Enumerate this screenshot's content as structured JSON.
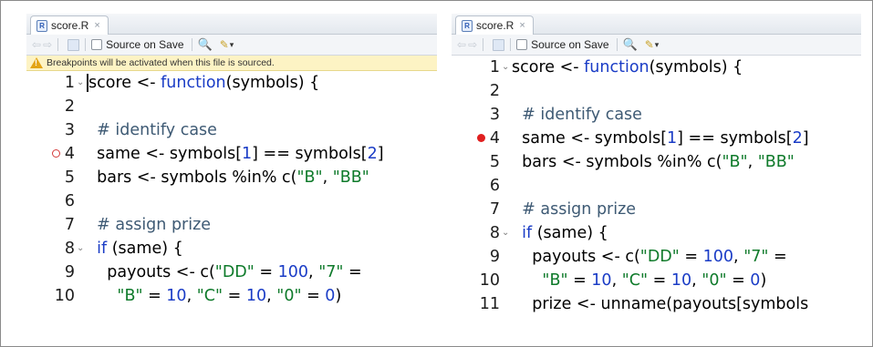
{
  "left_pane": {
    "tab": {
      "file_name": "score.R",
      "close": "×"
    },
    "toolbar": {
      "source_on_save": "Source on Save"
    },
    "notice": "Breakpoints will be activated when this file is sourced.",
    "breakpoint_line": 4,
    "lines": [
      {
        "n": "1",
        "fold": true,
        "html": "<span class=\"cursor\"></span>score &lt;- <span class=\"kw\">function</span>(symbols) {"
      },
      {
        "n": "2",
        "html": ""
      },
      {
        "n": "3",
        "html": "  <span class=\"cm\"># identify case</span>"
      },
      {
        "n": "4",
        "html": "  same &lt;- symbols[<span class=\"num\">1</span>] == symbols[<span class=\"num\">2</span>]"
      },
      {
        "n": "5",
        "html": "  bars &lt;- symbols %in% c(<span class=\"str\">\"B\"</span>, <span class=\"str\">\"BB\"</span>"
      },
      {
        "n": "6",
        "html": ""
      },
      {
        "n": "7",
        "html": "  <span class=\"cm\"># assign prize</span>"
      },
      {
        "n": "8",
        "fold": true,
        "html": "  <span class=\"kw\">if</span> (same) {"
      },
      {
        "n": "9",
        "html": "    payouts &lt;- c(<span class=\"str\">\"DD\"</span> = <span class=\"num\">100</span>, <span class=\"str\">\"7\"</span> ="
      },
      {
        "n": "10",
        "html": "      <span class=\"str\">\"B\"</span> = <span class=\"num\">10</span>, <span class=\"str\">\"C\"</span> = <span class=\"num\">10</span>, <span class=\"str\">\"0\"</span> = <span class=\"num\">0</span>)"
      }
    ]
  },
  "right_pane": {
    "tab": {
      "file_name": "score.R",
      "close": "×"
    },
    "toolbar": {
      "source_on_save": "Source on Save"
    },
    "breakpoint_line": 4,
    "lines": [
      {
        "n": "1",
        "fold": true,
        "html": "score &lt;- <span class=\"kw\">function</span>(symbols) {"
      },
      {
        "n": "2",
        "html": ""
      },
      {
        "n": "3",
        "html": "  <span class=\"cm\"># identify case</span>"
      },
      {
        "n": "4",
        "html": "  same &lt;- symbols[<span class=\"num\">1</span>] == symbols[<span class=\"num\">2</span>]"
      },
      {
        "n": "5",
        "html": "  bars &lt;- symbols %in% c(<span class=\"str\">\"B\"</span>, <span class=\"str\">\"BB\"</span>"
      },
      {
        "n": "6",
        "html": ""
      },
      {
        "n": "7",
        "html": "  <span class=\"cm\"># assign prize</span>"
      },
      {
        "n": "8",
        "fold": true,
        "html": "  <span class=\"kw\">if</span> (same) {"
      },
      {
        "n": "9",
        "html": "    payouts &lt;- c(<span class=\"str\">\"DD\"</span> = <span class=\"num\">100</span>, <span class=\"str\">\"7\"</span> ="
      },
      {
        "n": "10",
        "html": "      <span class=\"str\">\"B\"</span> = <span class=\"num\">10</span>, <span class=\"str\">\"C\"</span> = <span class=\"num\">10</span>, <span class=\"str\">\"0\"</span> = <span class=\"num\">0</span>)"
      },
      {
        "n": "11",
        "html": "    prize &lt;- unname(payouts[symbols"
      }
    ]
  },
  "icons": {
    "fold": "⌄",
    "back": "⇦",
    "forward": "⇨",
    "search": "🔍",
    "wand": "✎",
    "caret": "▾"
  },
  "colors": {
    "keyword": "#1a3cc6",
    "string": "#0e7a2a",
    "comment": "#3e5a74",
    "breakpoint_active": "#e01f1f",
    "breakpoint_inactive": "#d43a3a",
    "notice_bg": "#fdf3c4"
  }
}
